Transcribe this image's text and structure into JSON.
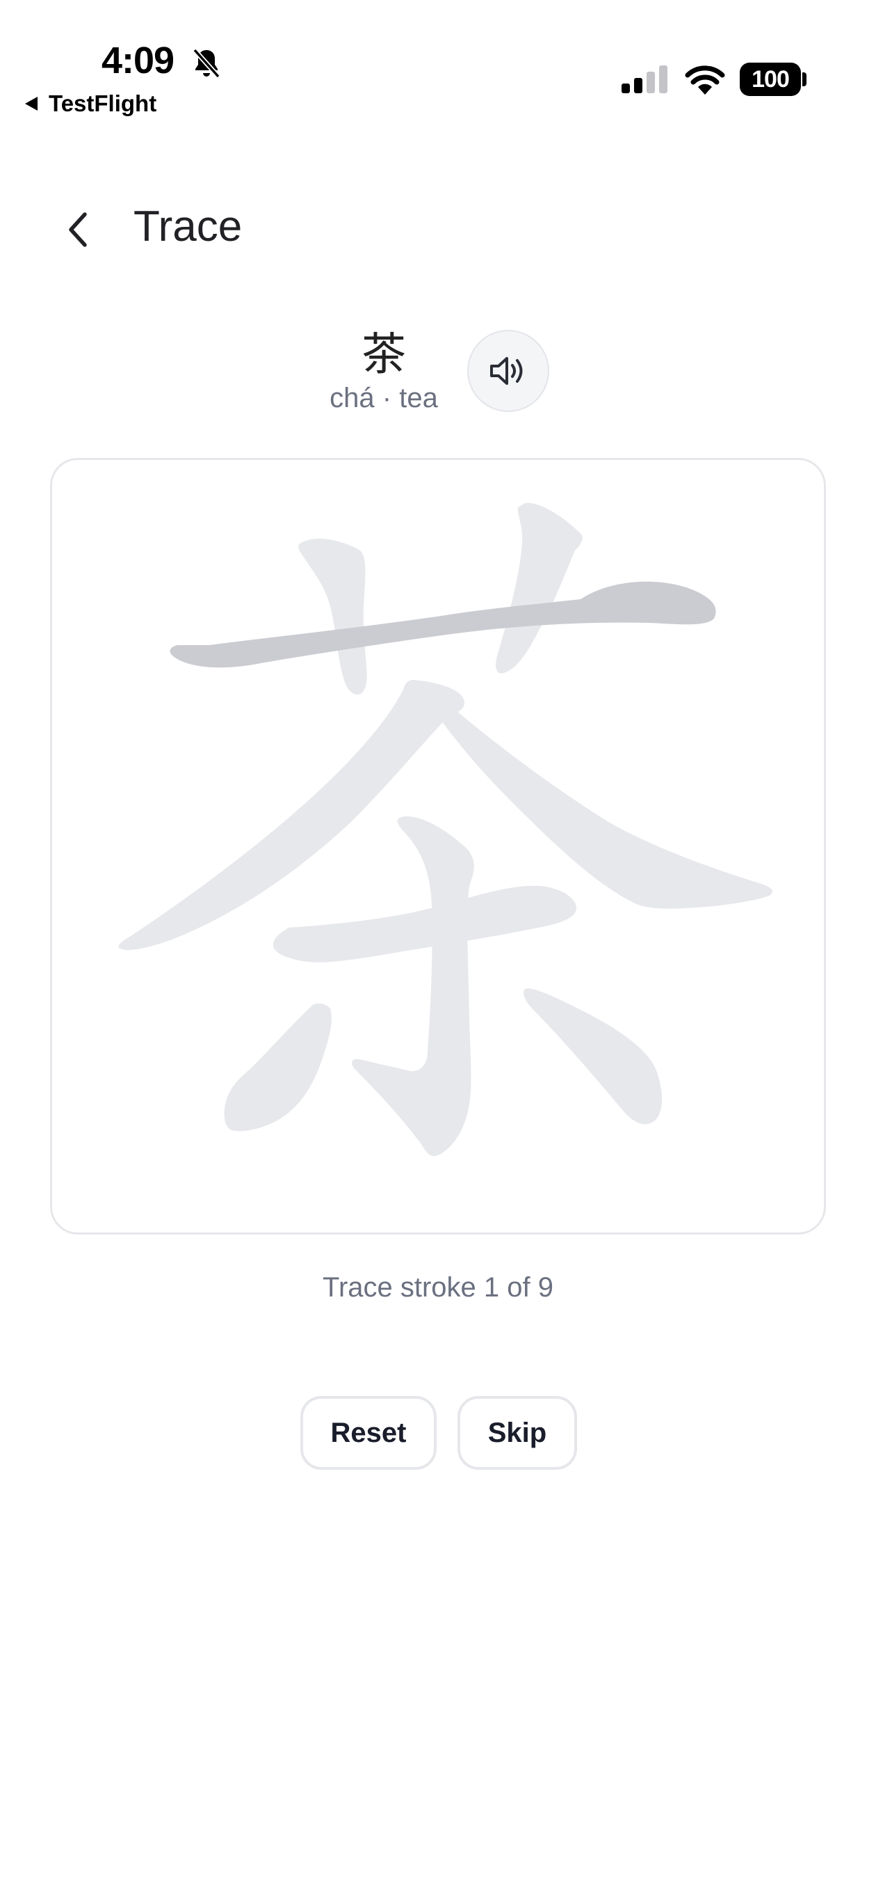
{
  "status_bar": {
    "time": "4:09",
    "back_app": "TestFlight",
    "battery": "100"
  },
  "header": {
    "title": "Trace"
  },
  "character": {
    "hanzi": "茶",
    "pinyin_meaning": "chá · tea"
  },
  "trace": {
    "progress": "Trace stroke 1 of 9",
    "current_stroke": 1,
    "total_strokes": 9,
    "highlight_color": "#cbccd1",
    "guide_color": "#e7e8eb"
  },
  "buttons": {
    "reset": "Reset",
    "skip": "Skip"
  }
}
